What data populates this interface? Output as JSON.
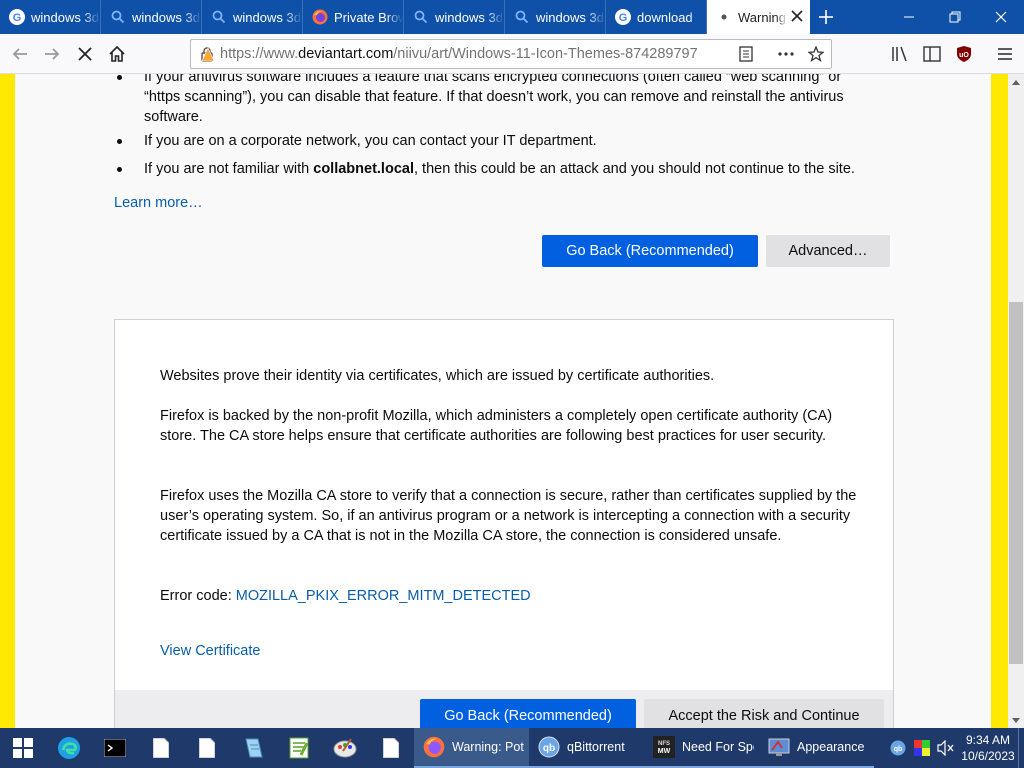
{
  "browser": {
    "tabs": [
      {
        "label": "windows 3d",
        "icon": "google-icon"
      },
      {
        "label": "windows 3d",
        "icon": "search-icon"
      },
      {
        "label": "windows 3d",
        "icon": "search-icon"
      },
      {
        "label": "Private Browsing",
        "icon": "firefox-icon"
      },
      {
        "label": "windows 3d",
        "icon": "search-icon"
      },
      {
        "label": "windows 3d",
        "icon": "search-icon"
      },
      {
        "label": "download",
        "icon": "google-icon"
      },
      {
        "label": "Warning",
        "icon": "loading-dot-icon",
        "active": true
      }
    ],
    "url_prefix": "https://www.",
    "url_domain": "deviantart.com",
    "url_rest": "/niivu/art/Windows-11-Icon-Themes-874289797"
  },
  "page": {
    "bullet_1": "If your antivirus software includes a feature that scans encrypted connections (often called “web scanning” or “https scanning”), you can disable that feature. If that doesn’t work, you can remove and reinstall the antivirus software.",
    "bullet_2": "If you are on a corporate network, you can contact your IT department.",
    "bullet_3_pre": "If you are not familiar with ",
    "bullet_3_bold": "collabnet.local",
    "bullet_3_post": ", then this could be an attack and you should not continue to the site.",
    "learn_more": "Learn more…",
    "go_back": "Go Back (Recommended)",
    "advanced": "Advanced…",
    "adv_p1": "Websites prove their identity via certificates, which are issued by certificate authorities.",
    "adv_p2": "Firefox is backed by the non-profit Mozilla, which administers a completely open certificate authority (CA) store. The CA store helps ensure that certificate authorities are following best practices for user security.",
    "adv_p3": "Firefox uses the Mozilla CA store to verify that a connection is secure, rather than certificates supplied by the user’s operating system. So, if an antivirus program or a network is intercepting a connection with a security certificate issued by a CA that is not in the Mozilla CA store, the connection is considered unsafe.",
    "error_code_label": "Error code: ",
    "error_code": "MOZILLA_PKIX_ERROR_MITM_DETECTED",
    "view_certificate": "View Certificate",
    "go_back_2": "Go Back (Recommended)",
    "accept_risk": "Accept the Risk and Continue"
  },
  "taskbar": {
    "apps": [
      {
        "label": "Warning: Potential Security Risk",
        "icon": "firefox-icon",
        "active": true
      },
      {
        "label": "qBittorrent",
        "icon": "qbittorrent-icon"
      },
      {
        "label": "Need For Speed Most Wanted",
        "icon": "nfs-icon"
      },
      {
        "label": "Appearance",
        "icon": "appearance-icon"
      }
    ],
    "time": "9:34 AM",
    "date": "10/6/2023"
  },
  "colors": {
    "tab_strip": "#0f51a8",
    "primary_button": "#0060df",
    "link": "#0a5ea9",
    "warning_border": "#ffe900",
    "taskbar": "#1f3a6a"
  }
}
